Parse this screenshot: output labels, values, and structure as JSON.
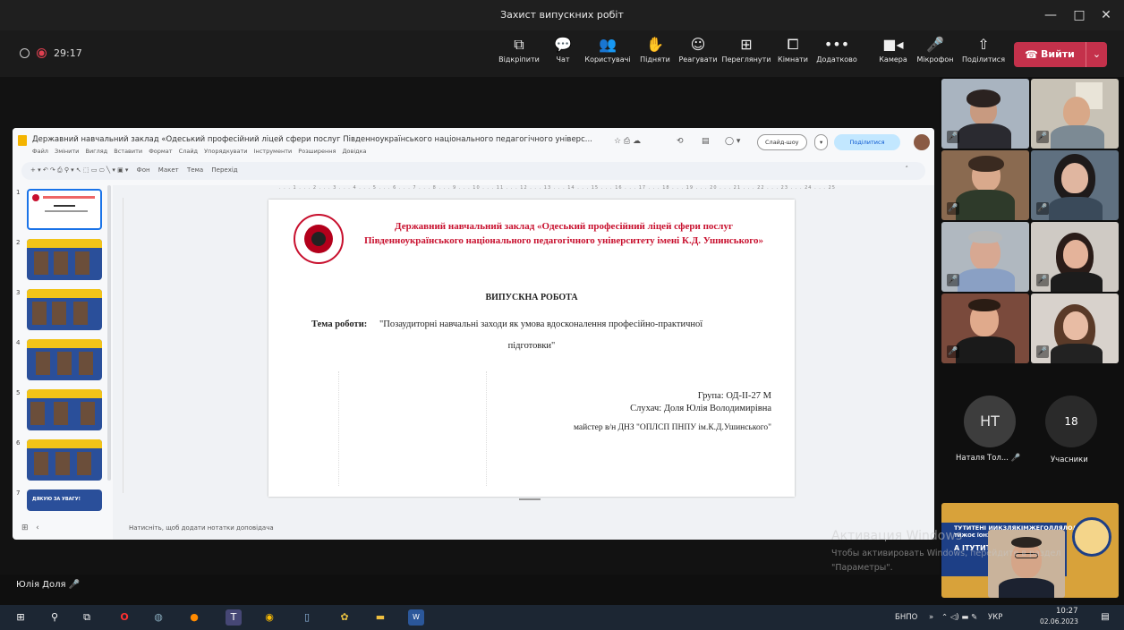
{
  "window": {
    "title": "Захист випускних робіт"
  },
  "meeting": {
    "timer": "29:17",
    "toolbar": [
      {
        "icon": "popout-icon",
        "label": "Відкріпити"
      },
      {
        "icon": "chat-icon",
        "label": "Чат"
      },
      {
        "icon": "people-icon",
        "label": "Користувачі"
      },
      {
        "icon": "raise-hand-icon",
        "label": "Підняти"
      },
      {
        "icon": "react-icon",
        "label": "Реагувати"
      },
      {
        "icon": "view-icon",
        "label": "Переглянути"
      },
      {
        "icon": "rooms-icon",
        "label": "Кімнати"
      },
      {
        "icon": "more-icon",
        "label": "Додатково"
      },
      {
        "icon": "camera-icon",
        "label": "Камера"
      },
      {
        "icon": "mic-icon",
        "label": "Мікрофон"
      },
      {
        "icon": "share-icon",
        "label": "Поділитися"
      }
    ],
    "leave_label": "Вийти",
    "self_name": "Юлія Доля",
    "participants_count": "18",
    "participants_label": "Учасники",
    "nt_initials": "НТ",
    "nt_name": "Наталя Тол..."
  },
  "slides_app": {
    "doc_title": "Державний навчальний заклад «Одеський професійний ліцей сфери послуг Південноукраїнського національного педагогічного універс...",
    "menu": [
      "Файл",
      "Змінити",
      "Вигляд",
      "Вставити",
      "Формат",
      "Слайд",
      "Упорядкувати",
      "Інструменти",
      "Розширення",
      "Довідка"
    ],
    "toolbar_items": [
      "Фон",
      "Макет",
      "Тема",
      "Перехід"
    ],
    "slideshow_label": "Слайд-шоу",
    "share_label": "Поділитися",
    "notes_placeholder": "Натисніть, щоб додати нотатки доповідача",
    "slide_numbers": [
      "1",
      "2",
      "3",
      "4",
      "5",
      "6",
      "7"
    ],
    "slide": {
      "heading1": "Державний навчальний заклад «Одеський професійний ліцей сфери послуг",
      "heading2": "Південноукраїнського національного педагогічного університету імені К.Д. Ушинського»",
      "work_title": "ВИПУСКНА РОБОТА",
      "topic_label": "Тема роботи:",
      "topic_text": "\"Позаудиторні навчальні заходи як умова вдосконалення професійно-практичної",
      "topic_text2": "підготовки\"",
      "group": "Група: ОД-ІІ-27 М",
      "student": "Слухач: Доля Юлія Володимирівна",
      "master": "майстер в/н ДНЗ \"ОПЛСП ПНПУ ім.К.Д.Ушинського\""
    },
    "thumb7_text": "ДЯКУЮ ЗА УВАГУ!"
  },
  "banner": {
    "line1": "ТУТИТЕНІ ИИКЗЛЯКІМЖЕГОЛЛЯЛОЛИЄ",
    "line2": "ТИЖОЄ ЇОНХЗЙОФОЧП ХИНСІІЛ",
    "line3": "A ІТУТИТЕНІ"
  },
  "activation": {
    "line1": "Активация Windows",
    "line2": "Чтобы активировать Windows, перейдите в раздел",
    "line3": "\"Параметры\"."
  },
  "taskbar": {
    "lang_extra": "БНПО",
    "lang": "УКР",
    "time": "10:27",
    "date": "02.06.2023"
  }
}
